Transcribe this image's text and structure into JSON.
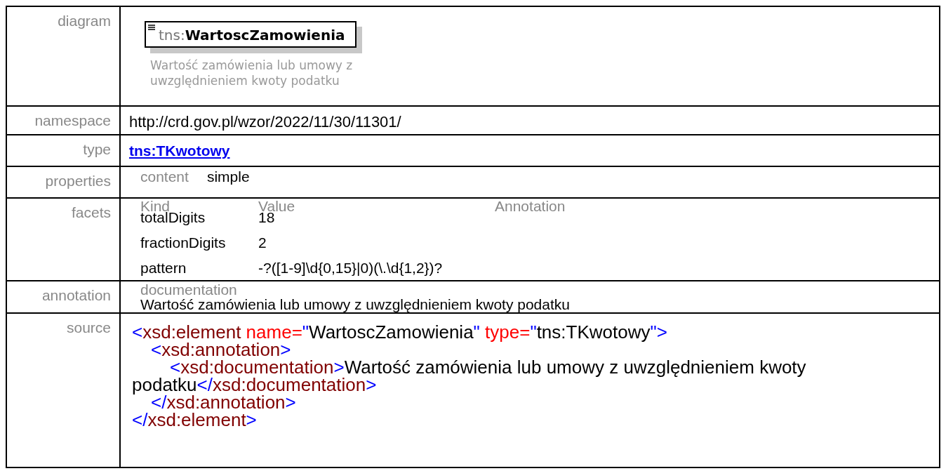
{
  "rows": [
    {
      "label": "diagram",
      "kind": "diagram",
      "prefix": "tns:",
      "name": "WartoscZamowienia",
      "description": [
        "Wartość zamówienia lub umowy z",
        "uwzględnieniem kwoty podatku"
      ]
    },
    {
      "label": "namespace",
      "kind": "text",
      "value": "http://crd.gov.pl/wzor/2022/11/30/11301/"
    },
    {
      "label": "type",
      "kind": "link",
      "value": "tns:TKwotowy"
    },
    {
      "label": "properties",
      "kind": "properties",
      "items": [
        {
          "key": "content",
          "value": "simple"
        }
      ]
    },
    {
      "label": "facets",
      "kind": "facets",
      "columns": [
        "Kind",
        "Value",
        "Annotation"
      ],
      "items": [
        {
          "kind": "totalDigits",
          "value": "18"
        },
        {
          "kind": "fractionDigits",
          "value": "2"
        },
        {
          "kind": "pattern",
          "value": "-?([1-9]\\d{0,15}|0)(\\.\\d{1,2})?"
        }
      ]
    },
    {
      "label": "annotation",
      "kind": "annotation",
      "title": "documentation",
      "text": "Wartość zamówienia lub umowy z uwzględnieniem kwoty podatku"
    },
    {
      "label": "source",
      "kind": "source",
      "code": {
        "open": [
          {
            "kind": "bracket",
            "text": "<"
          },
          {
            "kind": "tag",
            "text": "xsd:element"
          },
          {
            "kind": "attr",
            "text": " name="
          },
          {
            "kind": "bracket",
            "text": "\""
          },
          {
            "kind": "text",
            "text": "WartoscZamowienia"
          },
          {
            "kind": "bracket",
            "text": "\""
          },
          {
            "kind": "attr",
            "text": " type="
          },
          {
            "kind": "bracket",
            "text": "\""
          },
          {
            "kind": "text",
            "text": "tns:TKwotowy"
          },
          {
            "kind": "bracket",
            "text": "\">"
          }
        ],
        "children": [
          {
            "open": [
              {
                "kind": "bracket",
                "text": "<"
              },
              {
                "kind": "tag",
                "text": "xsd:annotation"
              },
              {
                "kind": "bracket",
                "text": ">"
              }
            ],
            "children": [
              {
                "open": [
                  {
                    "kind": "bracket",
                    "text": "<"
                  },
                  {
                    "kind": "tag",
                    "text": "xsd:documentation"
                  },
                  {
                    "kind": "bracket",
                    "text": ">"
                  },
                  {
                    "kind": "text",
                    "text": "Wartość zamówienia lub umowy z uwzględnieniem kwoty podatku"
                  },
                  {
                    "kind": "bracket",
                    "text": "</"
                  },
                  {
                    "kind": "tag",
                    "text": "xsd:documentation"
                  },
                  {
                    "kind": "bracket",
                    "text": ">"
                  }
                ]
              }
            ],
            "close": [
              {
                "kind": "bracket",
                "text": "</"
              },
              {
                "kind": "tag",
                "text": "xsd:annotation"
              },
              {
                "kind": "bracket",
                "text": ">"
              }
            ]
          }
        ],
        "close": [
          {
            "kind": "bracket",
            "text": "</"
          },
          {
            "kind": "tag",
            "text": "xsd:element"
          },
          {
            "kind": "bracket",
            "text": ">"
          }
        ]
      }
    }
  ]
}
